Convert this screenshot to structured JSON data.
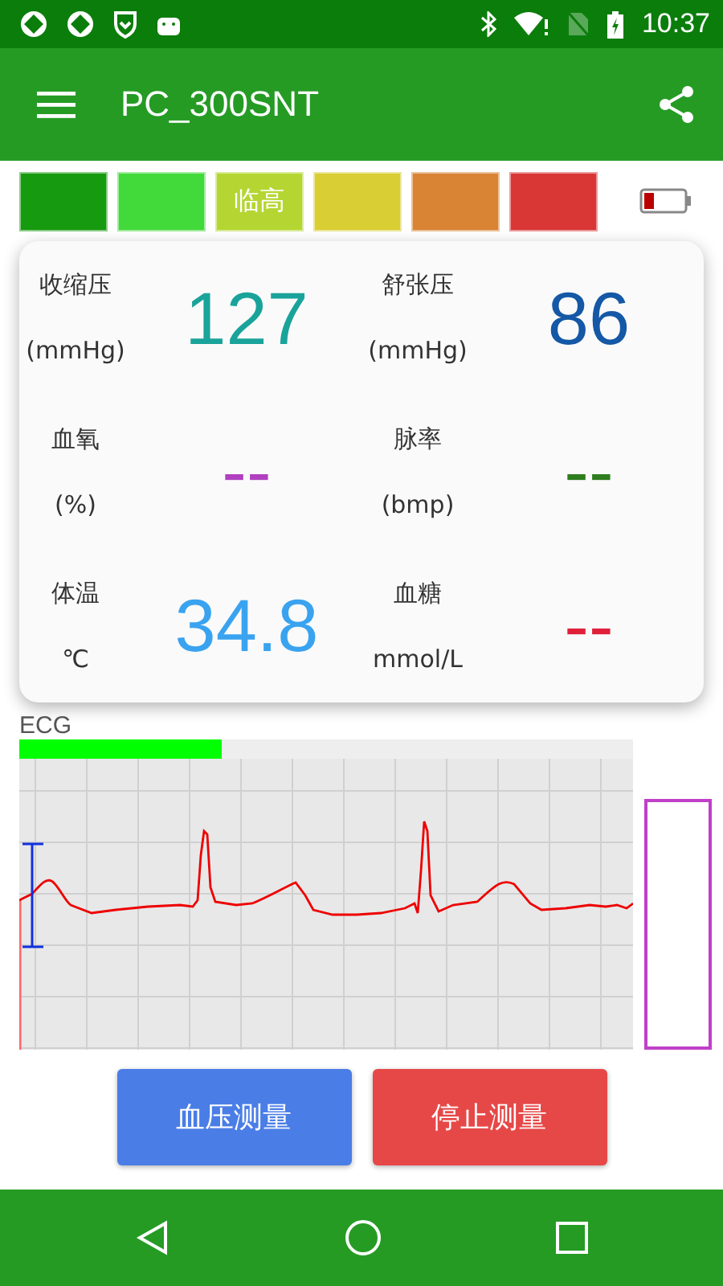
{
  "status_bar": {
    "time": "10:37"
  },
  "toolbar": {
    "title": "PC_300SNT"
  },
  "level_scale": [
    {
      "color": "#169a0f"
    },
    {
      "color": "#42d93a"
    },
    {
      "color": "#b5d632",
      "label": "临高"
    },
    {
      "color": "#d9ce33"
    },
    {
      "color": "#d98434"
    },
    {
      "color": "#d93636"
    }
  ],
  "vitals": [
    {
      "name": "收缩压",
      "unit": "(mmHg)",
      "value": "127",
      "color": "#1aa39a"
    },
    {
      "name": "舒张压",
      "unit": "(mmHg)",
      "value": "86",
      "color": "#1458a6"
    },
    {
      "name": "血氧",
      "unit": "(%)",
      "value": "--",
      "color": "#b040c0"
    },
    {
      "name": "脉率",
      "unit": "(bmp)",
      "value": "--",
      "color": "#2e7d1e"
    },
    {
      "name": "体温",
      "unit": "℃",
      "value": "34.8",
      "color": "#3aa3f0"
    },
    {
      "name": "血糖",
      "unit": "mmol/L",
      "value": "--",
      "color": "#e0203a"
    }
  ],
  "ecg": {
    "label": "ECG",
    "progress": {
      "level": 0.33
    }
  },
  "buttons": [
    {
      "label": "血压测量",
      "kind": "primary"
    },
    {
      "label": "停止测量",
      "kind": "danger"
    }
  ]
}
